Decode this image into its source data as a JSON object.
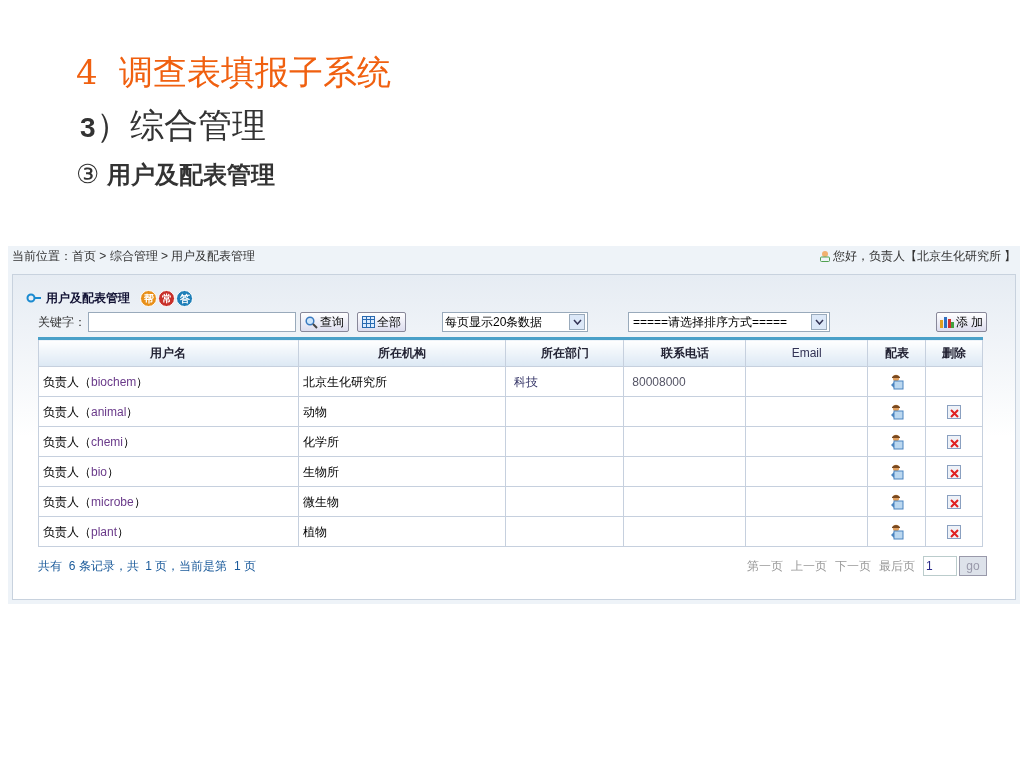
{
  "slide": {
    "title_number": "4",
    "title": "调查表填报子系统",
    "section_number": "3",
    "section": "）综合管理",
    "subsection_mark": "③",
    "subsection": "用户及配表管理"
  },
  "app": {
    "breadcrumb": "当前位置：首页 > 综合管理 > 用户及配表管理",
    "greeting": "您好，负责人【北京生化研究所 】",
    "panel_title": "用户及配表管理",
    "badges": [
      {
        "label": "帮",
        "color": "#e8901a"
      },
      {
        "label": "常",
        "color": "#c8302a"
      },
      {
        "label": "答",
        "color": "#1f7fb8"
      }
    ],
    "keyword_label": "关键字：",
    "search_button": "查询",
    "all_button": "全部",
    "page_size": "每页显示20条数据",
    "sort": "=====请选择排序方式=====",
    "add_button": "添 加",
    "columns": [
      "用户名",
      "所在机构",
      "所在部门",
      "联系电话",
      "Email",
      "配表",
      "删除"
    ],
    "rows": [
      {
        "prefix": "负责人（",
        "login": "biochem）",
        "org": "北京生化研究所",
        "dept": "科技",
        "phone": "80008000",
        "deletable": false
      },
      {
        "prefix": "负责人（",
        "login": "animal）",
        "org": "动物",
        "deletable": true
      },
      {
        "prefix": "负责人（",
        "login": "chemi）",
        "org": "化学所",
        "deletable": true
      },
      {
        "prefix": "负责人（",
        "login": "bio）",
        "org": "生物所",
        "deletable": true
      },
      {
        "prefix": "负责人（",
        "login": "microbe）",
        "org": "微生物",
        "deletable": true
      },
      {
        "prefix": "负责人（",
        "login": "plant）",
        "org": "植物",
        "deletable": true
      }
    ],
    "summary": "共有  6 条记录，共  1 页，当前是第  1 页",
    "pager": [
      "第一页",
      "上一页",
      "下一页",
      "最后页"
    ],
    "page_value": "1",
    "go_button": "go"
  }
}
